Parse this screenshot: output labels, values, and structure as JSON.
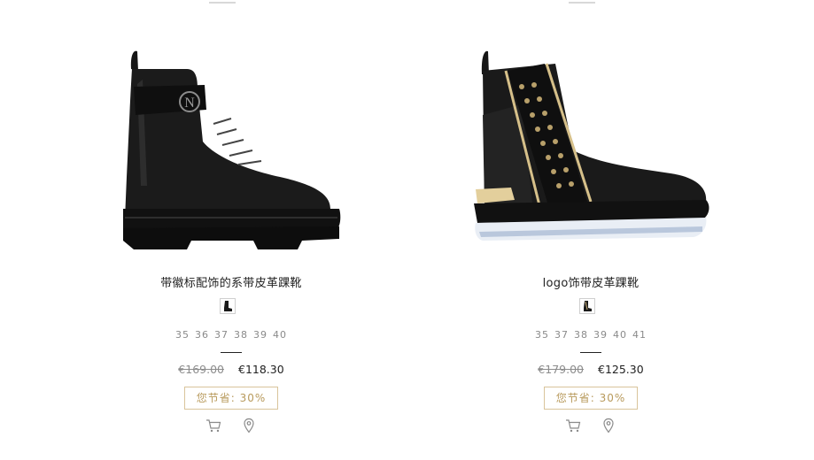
{
  "products": [
    {
      "name": "带徽标配饰的系带皮革踝靴",
      "sizes": [
        "35",
        "36",
        "37",
        "38",
        "39",
        "40"
      ],
      "old_price": "€169.00",
      "new_price": "€118.30",
      "saving": "您节省:  30%"
    },
    {
      "name": "logo饰带皮革踝靴",
      "sizes": [
        "35",
        "37",
        "38",
        "39",
        "40",
        "41"
      ],
      "old_price": "€179.00",
      "new_price": "€125.30",
      "saving": "您节省:  30%"
    }
  ],
  "icons": {
    "cart": "cart-icon",
    "store": "location-pin-icon",
    "thumb": "boot-thumbnail-icon"
  },
  "colors": {
    "accent_gold": "#b89a5c",
    "text": "#222222",
    "muted": "#8a8a8a"
  }
}
